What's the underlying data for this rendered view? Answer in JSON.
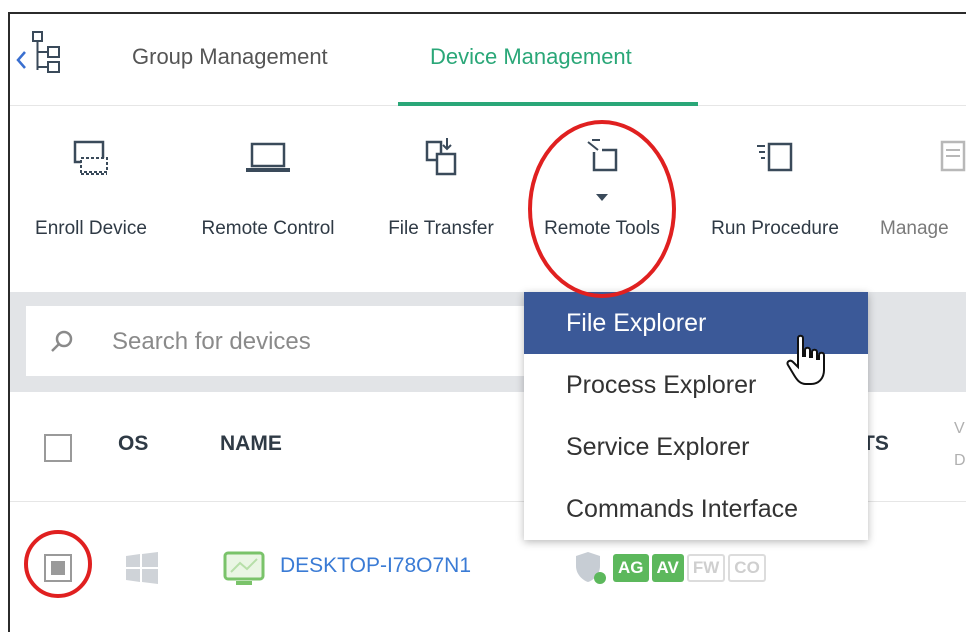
{
  "tabs": [
    {
      "label": "Group Management",
      "active": false
    },
    {
      "label": "Device Management",
      "active": true
    }
  ],
  "toolbar": {
    "enroll_device": "Enroll Device",
    "remote_control": "Remote Control",
    "file_transfer": "File Transfer",
    "remote_tools": "Remote Tools",
    "run_procedure": "Run Procedure",
    "manage": "Manage"
  },
  "search": {
    "placeholder": "Search for devices"
  },
  "table": {
    "columns": {
      "os": "OS",
      "name": "NAME",
      "cut_col": "TS",
      "faint_col_1": "V",
      "faint_col_2": "D"
    }
  },
  "row": {
    "device_name": "DESKTOP-I78O7N1",
    "badges": [
      {
        "label": "AG",
        "active": true
      },
      {
        "label": "AV",
        "active": true
      },
      {
        "label": "FW",
        "active": false
      },
      {
        "label": "CO",
        "active": false
      }
    ]
  },
  "dropdown": {
    "items": [
      "File Explorer",
      "Process Explorer",
      "Service Explorer",
      "Commands Interface"
    ],
    "highlighted": 0
  },
  "colors": {
    "accent": "#2aa778",
    "highlight": "#3b5998",
    "link": "#3a7bd5",
    "annotation": "#e02020",
    "badge_on": "#5cb85c"
  },
  "icons": [
    "back-chevron-icon",
    "tree-icon",
    "enroll-device-icon",
    "laptop-icon",
    "file-transfer-icon",
    "remote-tools-icon",
    "run-procedure-icon",
    "manage-icon",
    "search-icon",
    "windows-icon",
    "monitor-icon",
    "shield-icon",
    "hand-cursor-icon"
  ]
}
